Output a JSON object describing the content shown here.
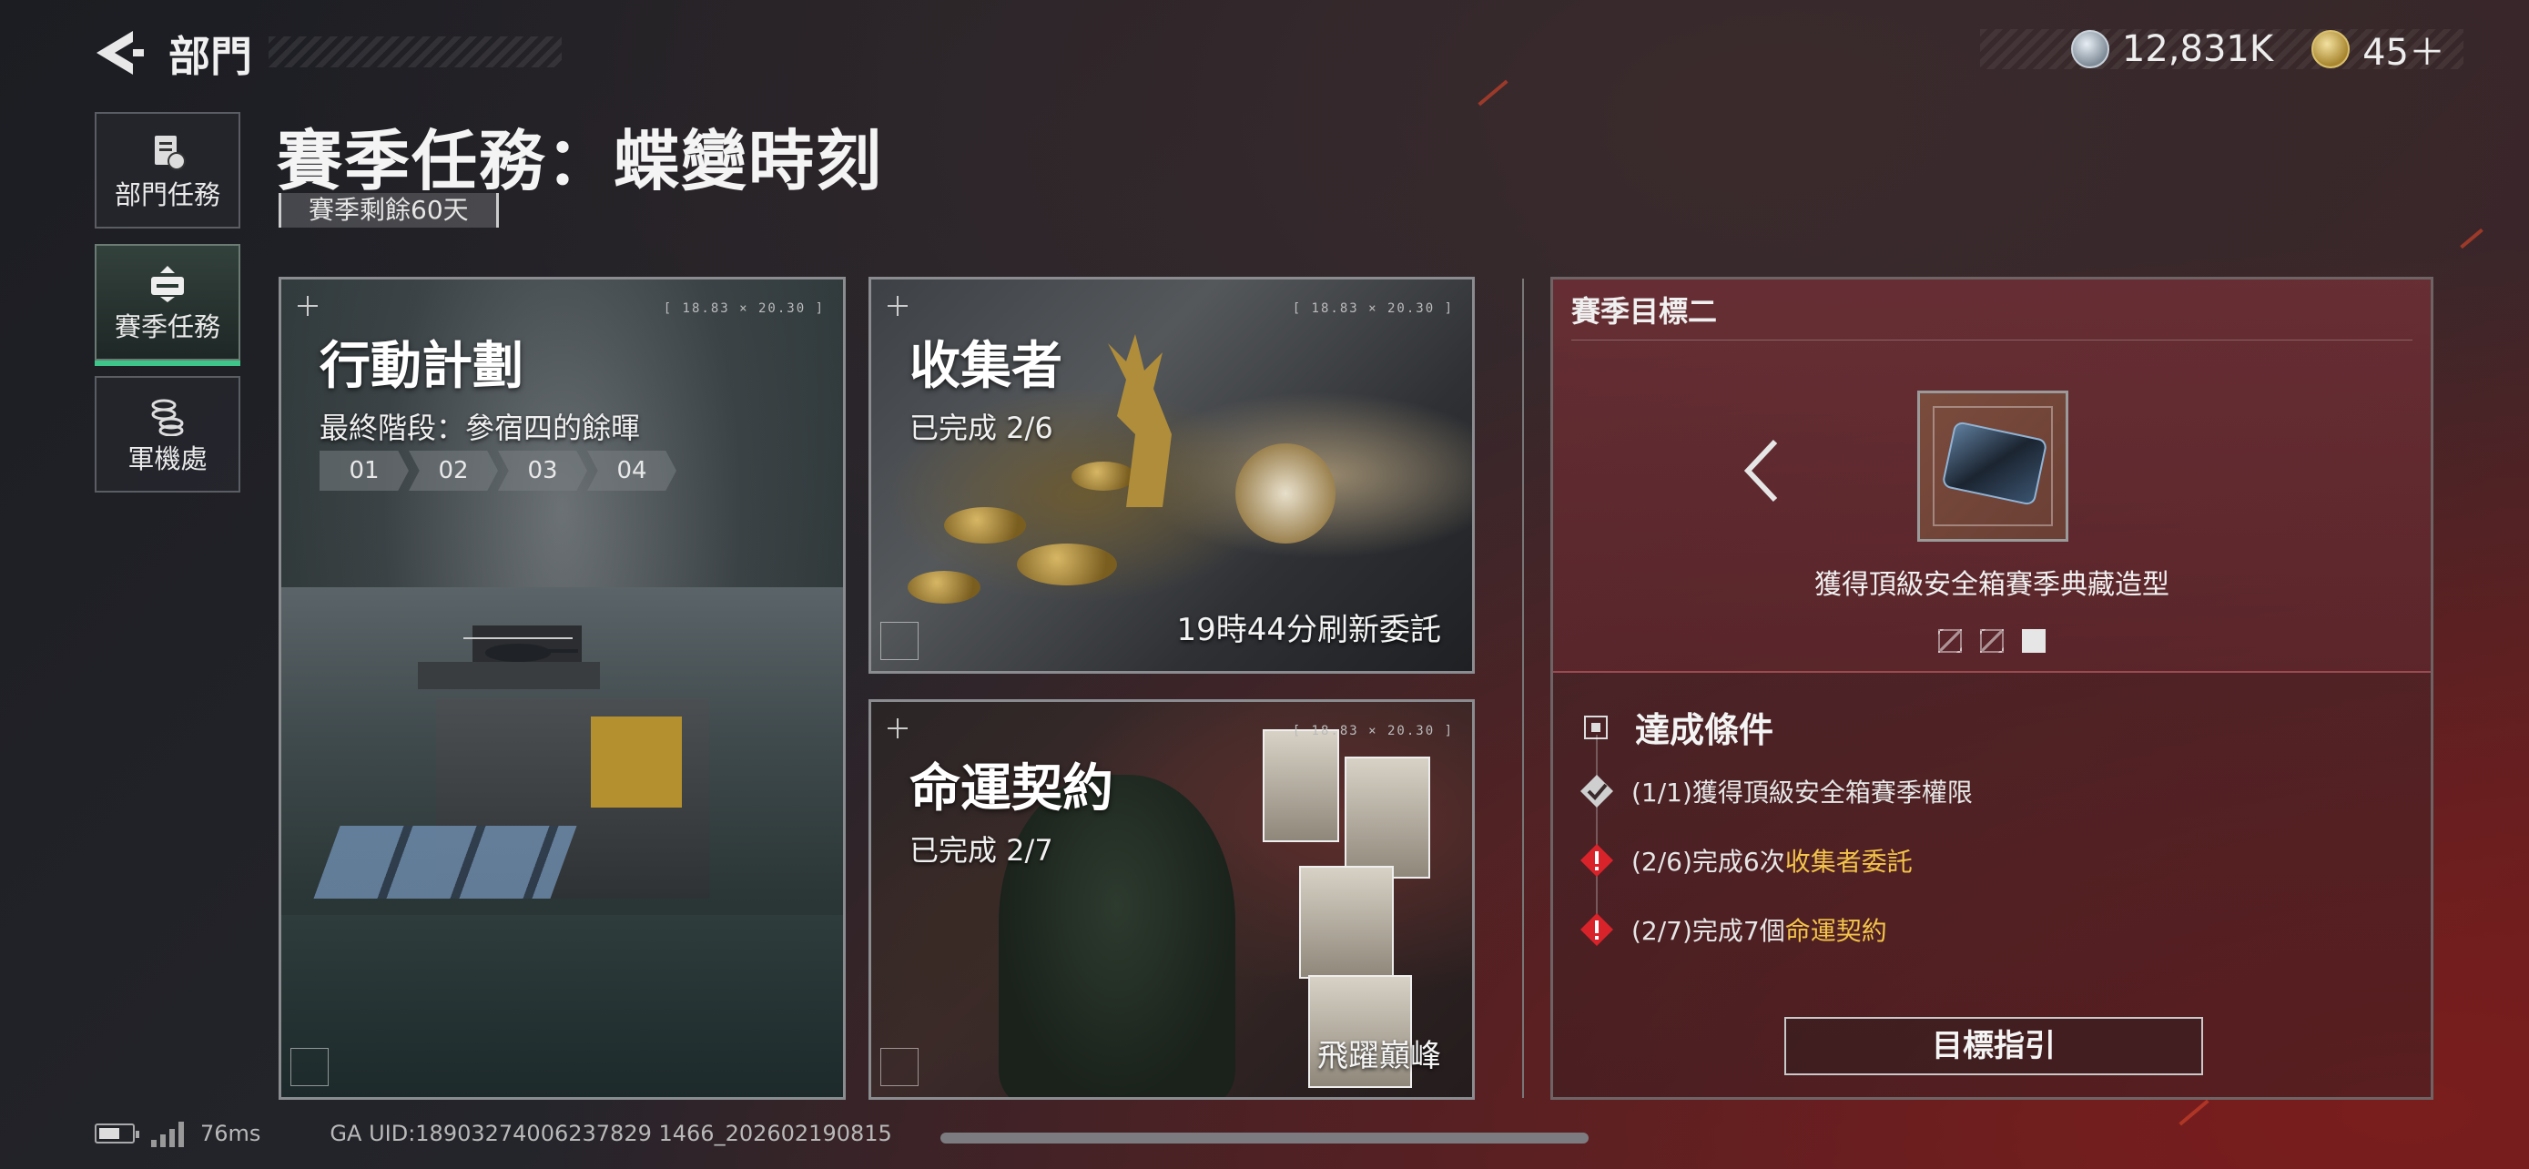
{
  "header": {
    "back_label": "部門",
    "currency": [
      {
        "icon": "silver-coin-icon",
        "value": "12,831K"
      },
      {
        "icon": "gold-coin-icon",
        "value": "45＋"
      }
    ]
  },
  "sidebar": {
    "items": [
      {
        "label": "部門任務",
        "icon": "document-icon",
        "active": false
      },
      {
        "label": "賽季任務",
        "icon": "season-task-icon",
        "active": true
      },
      {
        "label": "軍機處",
        "icon": "coin-stack-icon",
        "active": false
      }
    ]
  },
  "page": {
    "title": "賽季任務：蝶變時刻",
    "season_remaining": "賽季剩餘60天"
  },
  "cards": {
    "ops": {
      "title": "行動計劃",
      "subtitle": "最終階段：參宿四的餘暉",
      "steps": [
        "01",
        "02",
        "03",
        "04"
      ],
      "code": "[ 18.83 × 20.30 ]"
    },
    "collector": {
      "title": "收集者",
      "progress": "已完成 2/6",
      "footer": "19時44分刷新委託",
      "code": "[ 18.83 × 20.30 ]"
    },
    "fate": {
      "title": "命運契約",
      "progress": "已完成 2/7",
      "footer": "飛躍巔峰",
      "code": "[ 18.83 × 20.30 ]"
    }
  },
  "goal": {
    "title": "賽季目標二",
    "reward_desc": "獲得頂級安全箱賽季典藏造型",
    "page_count": 3,
    "active_page": 3,
    "conditions_title": "達成條件",
    "conditions": [
      {
        "status": "done",
        "prefix": "(1/1)獲得頂級安全箱賽季權限",
        "highlight": ""
      },
      {
        "status": "pending",
        "prefix": "(2/6)完成6次",
        "highlight": "收集者委託"
      },
      {
        "status": "pending",
        "prefix": "(2/7)完成7個",
        "highlight": "命運契約"
      }
    ],
    "guide_button": "目標指引",
    "highlight_color": "#f3c44a",
    "alert_color": "#d8232a"
  },
  "footer": {
    "ping": "76ms",
    "uid": "GA UID:18903274006237829 1466_202602190815"
  }
}
